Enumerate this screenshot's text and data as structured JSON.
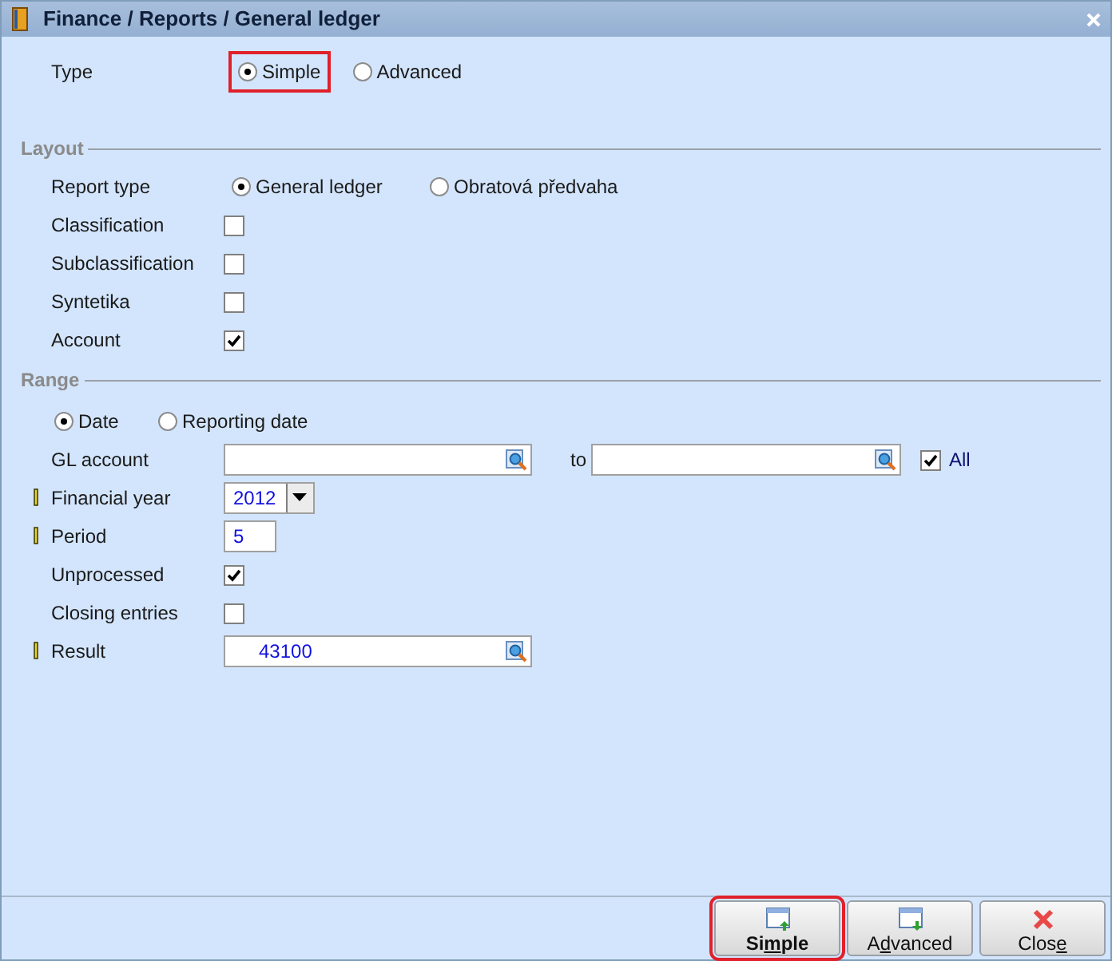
{
  "window": {
    "title": "Finance / Reports / General ledger"
  },
  "type": {
    "label": "Type",
    "options": [
      {
        "label": "Simple",
        "selected": true,
        "highlighted": true
      },
      {
        "label": "Advanced",
        "selected": false,
        "highlighted": false
      }
    ]
  },
  "layout": {
    "heading": "Layout",
    "report_type": {
      "label": "Report type",
      "options": [
        {
          "label": "General ledger",
          "selected": true
        },
        {
          "label": "Obratová předvaha",
          "selected": false
        }
      ]
    },
    "checks": [
      {
        "label": "Classification",
        "checked": false
      },
      {
        "label": "Subclassification",
        "checked": false
      },
      {
        "label": "Syntetika",
        "checked": false
      },
      {
        "label": "Account",
        "checked": true
      }
    ]
  },
  "range": {
    "heading": "Range",
    "date_mode": [
      {
        "label": "Date",
        "selected": true
      },
      {
        "label": "Reporting date",
        "selected": false
      }
    ],
    "fields": [
      {
        "kind": "lookup_range",
        "label": "GL account",
        "required": false,
        "to_label": "to",
        "all_label": "All",
        "all_checked": true
      },
      {
        "kind": "dropdown",
        "label": "Financial year",
        "required": true,
        "value": "2012"
      },
      {
        "kind": "text",
        "label": "Period",
        "required": true,
        "value": "5"
      },
      {
        "kind": "checkbox",
        "label": "Unprocessed",
        "required": false,
        "checked": true
      },
      {
        "kind": "checkbox",
        "label": "Closing entries",
        "required": false,
        "checked": false
      },
      {
        "kind": "lookup",
        "label": "Result",
        "required": true,
        "value": "43100"
      }
    ]
  },
  "buttons": [
    {
      "kind": "window-up",
      "label_parts": [
        "Si",
        "m",
        "ple"
      ],
      "default": true,
      "highlighted": true
    },
    {
      "kind": "window-down",
      "label_parts": [
        "A",
        "d",
        "vanced"
      ],
      "default": false,
      "highlighted": false
    },
    {
      "kind": "close",
      "label_parts": [
        "Clos",
        "e"
      ],
      "default": false,
      "highlighted": false
    }
  ]
}
